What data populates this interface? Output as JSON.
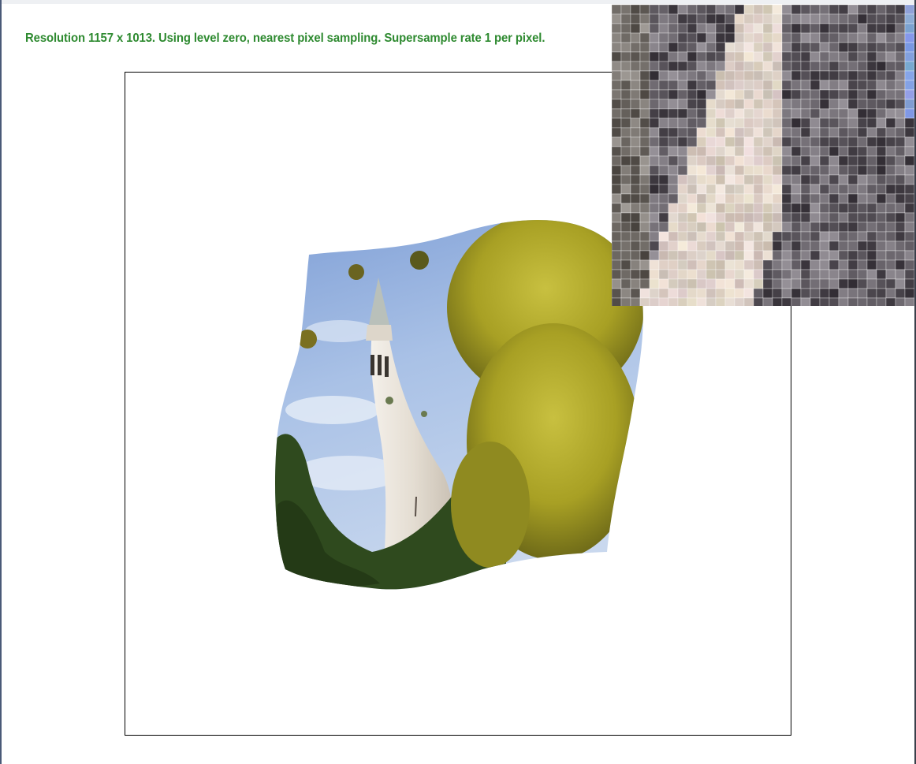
{
  "status": {
    "text": "Resolution 1157 x 1013. Using level zero, nearest pixel sampling. Supersample rate 1 per pixel.",
    "color": "#2e8a30"
  },
  "canvas": {
    "background": "#ffffff",
    "border_color": "#000000"
  },
  "rendered_image": {
    "subject": "campanile-tower-warped-photo",
    "sky_color": "#8fb0de",
    "tower_color": "#e8e2d8",
    "foliage_color": "#b8ad2a",
    "dark_foliage_color": "#2c4a1c"
  },
  "zoom_inset": {
    "subject": "pixel-magnifier",
    "grid_color": "#ffffff"
  }
}
